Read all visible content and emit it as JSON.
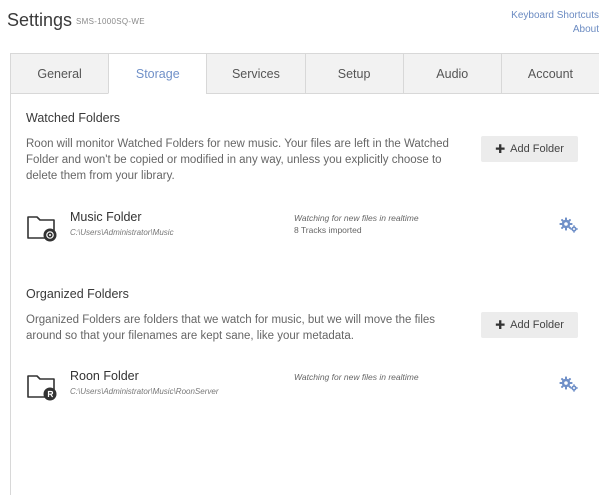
{
  "header": {
    "title": "Settings",
    "device_name": "SMS-1000SQ-WE",
    "links": [
      "Keyboard Shortcuts",
      "About"
    ]
  },
  "tabs": [
    {
      "label": "General",
      "active": false
    },
    {
      "label": "Storage",
      "active": true
    },
    {
      "label": "Services",
      "active": false
    },
    {
      "label": "Setup",
      "active": false
    },
    {
      "label": "Audio",
      "active": false
    },
    {
      "label": "Account",
      "active": false
    }
  ],
  "watched": {
    "title": "Watched Folders",
    "description": "Roon will monitor Watched Folders for new music. Your files are left in the Watched Folder and won't be copied or modified in any way, unless you explicitly choose to delete them from your library.",
    "add_button": "Add Folder",
    "folder": {
      "name": "Music Folder",
      "path": "C:\\Users\\Administrator\\Music",
      "status": "Watching for new files in realtime",
      "tracks": "8 Tracks imported"
    }
  },
  "organized": {
    "title": "Organized Folders",
    "description": "Organized Folders are folders that we watch for music, but we will move the files around so that your filenames are kept sane, like your metadata.",
    "add_button": "Add Folder",
    "folder": {
      "name": "Roon Folder",
      "path": "C:\\Users\\Administrator\\Music\\RoonServer",
      "status": "Watching for new files in realtime"
    }
  },
  "colors": {
    "accent": "#7090c8",
    "link": "#6b8bc2",
    "tab_bg": "#f2f2f2",
    "button_bg": "#ececec"
  },
  "icons": [
    "folder-music-icon",
    "folder-roon-icon",
    "gear-icon",
    "plus-icon"
  ]
}
